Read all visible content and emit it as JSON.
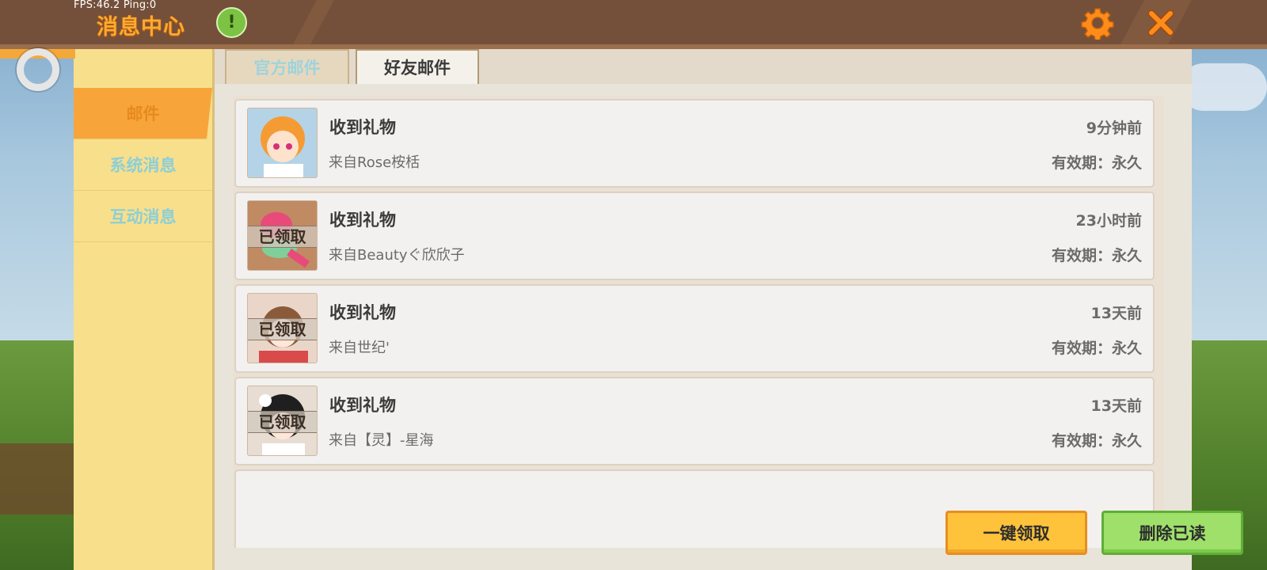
{
  "status": {
    "fps": "FPS:46.2  Ping:0"
  },
  "header": {
    "title": "消息中心",
    "alert_symbol": "!"
  },
  "sidebar": {
    "items": [
      {
        "label": "邮件",
        "active": true
      },
      {
        "label": "系统消息",
        "active": false
      },
      {
        "label": "互动消息",
        "active": false
      }
    ]
  },
  "tabs": [
    {
      "label": "官方邮件",
      "active": false
    },
    {
      "label": "好友邮件",
      "active": true
    }
  ],
  "mail": [
    {
      "title": "收到礼物",
      "from": "来自Rose桉栝",
      "time": "9分钟前",
      "validity": "有效期：永久",
      "claimed": false,
      "thumb_color": "#f2a03c"
    },
    {
      "title": "收到礼物",
      "from": "来自Beautyぐ欣欣子",
      "time": "23小时前",
      "validity": "有效期：永久",
      "claimed": true,
      "claimed_label": "已领取",
      "thumb_color": "#c08a63"
    },
    {
      "title": "收到礼物",
      "from": "来自世纪'",
      "time": "13天前",
      "validity": "有效期：永久",
      "claimed": true,
      "claimed_label": "已领取",
      "thumb_color": "#d9b29a"
    },
    {
      "title": "收到礼物",
      "from": "来自【灵】-星海",
      "time": "13天前",
      "validity": "有效期：永久",
      "claimed": true,
      "claimed_label": "已领取",
      "thumb_color": "#cdbba8"
    }
  ],
  "buttons": {
    "claim_all": "一键领取",
    "delete_read": "删除已读"
  },
  "icons": [
    "alert-icon",
    "gear-icon",
    "close-icon",
    "ring-icon"
  ],
  "colors": {
    "title_orange": "#ffaa2e",
    "topbar": "#74503a",
    "claim_yellow": "#ffc23b",
    "delete_green": "#9ee06a"
  }
}
